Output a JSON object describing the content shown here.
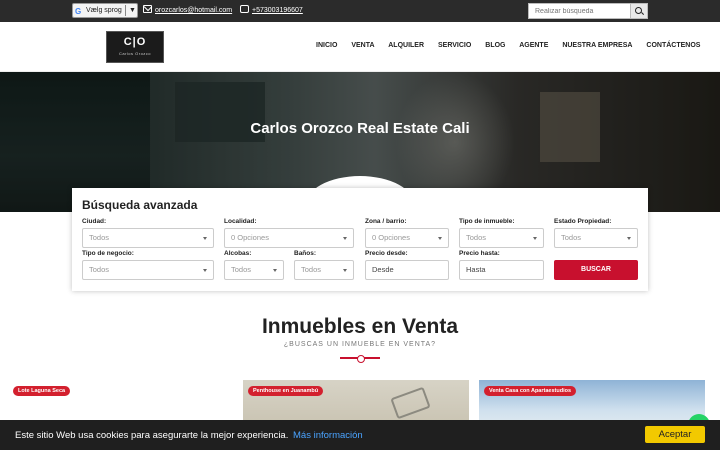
{
  "topbar": {
    "language": {
      "icon": "google-g-icon",
      "g": "G",
      "label": "Vælg sprog",
      "arrow": "▼"
    },
    "email": "orozcarlos@hotmail.com",
    "phone": "+573003196607",
    "search_placeholder": "Realizar búsqueda"
  },
  "logo": {
    "mark": "C|O",
    "subtitle": "Carlos Orozco"
  },
  "nav": [
    "INICIO",
    "VENTA",
    "ALQUILER",
    "SERVICIO",
    "BLOG",
    "AGENTE",
    "NUESTRA EMPRESA",
    "CONTÁCTENOS"
  ],
  "hero": {
    "title": "Carlos Orozco Real Estate Cali"
  },
  "search": {
    "title": "Búsqueda avanzada",
    "fields": {
      "ciudad": {
        "label": "Ciudad:",
        "value": "Todos"
      },
      "localidad": {
        "label": "Localidad:",
        "value": "0 Opciones"
      },
      "zona": {
        "label": "Zona / barrio:",
        "value": "0 Opciones"
      },
      "tipo_inmueble": {
        "label": "Tipo de inmueble:",
        "value": "Todos"
      },
      "estado": {
        "label": "Estado Propiedad:",
        "value": "Todos"
      },
      "tipo_negocio": {
        "label": "Tipo de negocio:",
        "value": "Todos"
      },
      "alcobas": {
        "label": "Alcobas:",
        "value": "Todos"
      },
      "banos": {
        "label": "Baños:",
        "value": "Todos"
      },
      "precio_desde": {
        "label": "Precio desde:",
        "placeholder": "Desde"
      },
      "precio_hasta": {
        "label": "Precio hasta:",
        "placeholder": "Hasta"
      }
    },
    "button": "BUSCAR"
  },
  "section": {
    "title": "Inmuebles en Venta",
    "subtitle": "¿BUSCAS UN INMUEBLE EN VENTA?"
  },
  "cards": [
    {
      "badge": "Lote Laguna Seca"
    },
    {
      "badge": "Penthouse en Juanambú"
    },
    {
      "badge": "Venta Casa con Apartaestudios"
    }
  ],
  "cookie": {
    "message": "Este sitio Web usa cookies para asegurarte la mejor experiencia.",
    "more": "Más información",
    "accept": "Aceptar"
  },
  "colors": {
    "accent": "#c8102e",
    "topbar": "#2b2b2b",
    "cookie_button": "#f2c900"
  }
}
